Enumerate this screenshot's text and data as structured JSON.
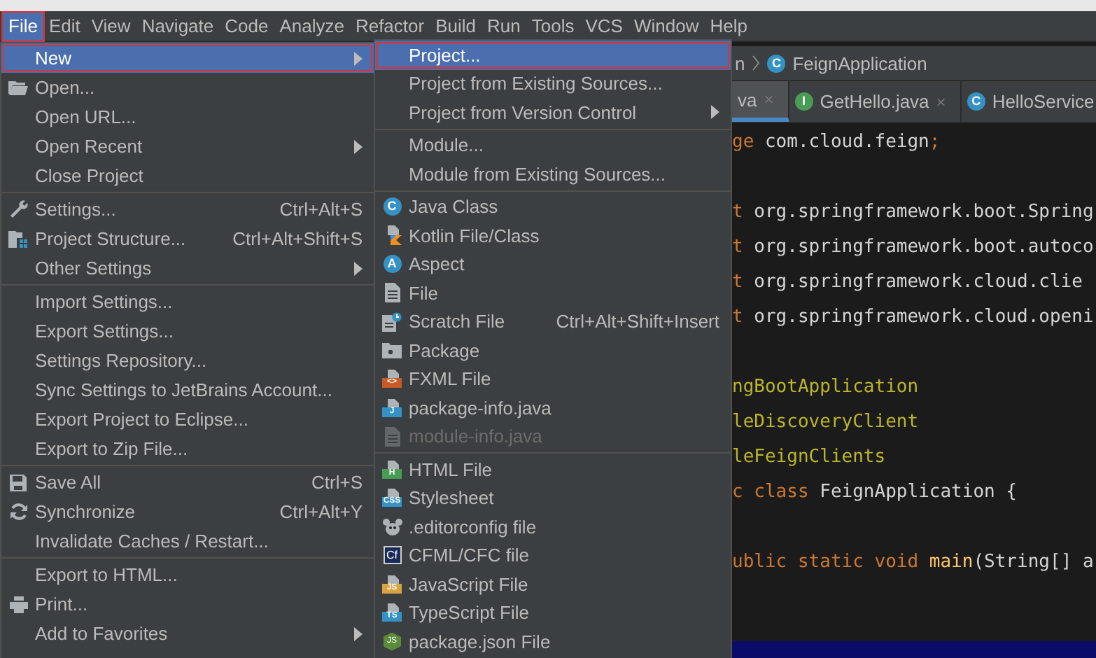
{
  "menubar": [
    {
      "label": "File",
      "selected": true,
      "outlined": true
    },
    {
      "label": "Edit",
      "selected": false,
      "outlined": false
    },
    {
      "label": "View",
      "selected": false,
      "outlined": false
    },
    {
      "label": "Navigate",
      "selected": false,
      "outlined": false
    },
    {
      "label": "Code",
      "selected": false,
      "outlined": false
    },
    {
      "label": "Analyze",
      "selected": false,
      "outlined": false
    },
    {
      "label": "Refactor",
      "selected": false,
      "outlined": false
    },
    {
      "label": "Build",
      "selected": false,
      "outlined": false
    },
    {
      "label": "Run",
      "selected": false,
      "outlined": false
    },
    {
      "label": "Tools",
      "selected": false,
      "outlined": false
    },
    {
      "label": "VCS",
      "selected": false,
      "outlined": false
    },
    {
      "label": "Window",
      "selected": false,
      "outlined": false
    },
    {
      "label": "Help",
      "selected": false,
      "outlined": false
    }
  ],
  "file_menu": [
    {
      "kind": "plain",
      "label": "New",
      "selected": true,
      "submenu": true,
      "outlined": true
    },
    {
      "kind": "folder",
      "label": "Open...",
      "selected": false,
      "submenu": false
    },
    {
      "kind": "plain",
      "label": "Open URL...",
      "selected": false,
      "submenu": false
    },
    {
      "kind": "plain",
      "label": "Open Recent",
      "selected": false,
      "submenu": true
    },
    {
      "kind": "plain",
      "label": "Close Project",
      "selected": false,
      "submenu": false
    },
    {
      "kind": "separator"
    },
    {
      "kind": "wrench",
      "label": "Settings...",
      "shortcut": "Ctrl+Alt+S",
      "selected": false,
      "submenu": false
    },
    {
      "kind": "structure",
      "label": "Project Structure...",
      "shortcut": "Ctrl+Alt+Shift+S",
      "selected": false,
      "submenu": false
    },
    {
      "kind": "plain",
      "label": "Other Settings",
      "selected": false,
      "submenu": true
    },
    {
      "kind": "separator"
    },
    {
      "kind": "plain",
      "label": "Import Settings...",
      "selected": false,
      "submenu": false
    },
    {
      "kind": "plain",
      "label": "Export Settings...",
      "selected": false,
      "submenu": false
    },
    {
      "kind": "plain",
      "label": "Settings Repository...",
      "selected": false,
      "submenu": false
    },
    {
      "kind": "plain",
      "label": "Sync Settings to JetBrains Account...",
      "selected": false,
      "submenu": false
    },
    {
      "kind": "plain",
      "label": "Export Project to Eclipse...",
      "selected": false,
      "submenu": false
    },
    {
      "kind": "plain",
      "label": "Export to Zip File...",
      "selected": false,
      "submenu": false
    },
    {
      "kind": "separator"
    },
    {
      "kind": "save",
      "label": "Save All",
      "shortcut": "Ctrl+S",
      "selected": false,
      "submenu": false
    },
    {
      "kind": "sync",
      "label": "Synchronize",
      "shortcut": "Ctrl+Alt+Y",
      "selected": false,
      "submenu": false
    },
    {
      "kind": "plain",
      "label": "Invalidate Caches / Restart...",
      "selected": false,
      "submenu": false
    },
    {
      "kind": "separator"
    },
    {
      "kind": "plain",
      "label": "Export to HTML...",
      "selected": false,
      "submenu": false
    },
    {
      "kind": "print",
      "label": "Print...",
      "selected": false,
      "submenu": false
    },
    {
      "kind": "plain",
      "label": "Add to Favorites",
      "selected": false,
      "submenu": true
    }
  ],
  "new_menu": [
    {
      "kind": "plain",
      "label": "Project...",
      "selected": true,
      "submenu": false,
      "disabled": false,
      "outlined": true
    },
    {
      "kind": "plain",
      "label": "Project from Existing Sources...",
      "selected": false,
      "submenu": false,
      "disabled": false
    },
    {
      "kind": "plain",
      "label": "Project from Version Control",
      "selected": false,
      "submenu": true,
      "disabled": false
    },
    {
      "kind": "separator"
    },
    {
      "kind": "plain",
      "label": "Module...",
      "selected": false,
      "submenu": false,
      "disabled": false
    },
    {
      "kind": "plain",
      "label": "Module from Existing Sources...",
      "selected": false,
      "submenu": false,
      "disabled": false
    },
    {
      "kind": "separator"
    },
    {
      "kind": "circle",
      "label": "Java Class",
      "icon_text": "C",
      "color": "#3592c4",
      "selected": false,
      "submenu": false,
      "disabled": false
    },
    {
      "kind": "kotlin",
      "label": "Kotlin File/Class",
      "selected": false,
      "submenu": false,
      "disabled": false
    },
    {
      "kind": "circle",
      "label": "Aspect",
      "icon_text": "A",
      "color": "#3592c4",
      "selected": false,
      "submenu": false,
      "disabled": false
    },
    {
      "kind": "file",
      "label": "File",
      "selected": false,
      "submenu": false,
      "disabled": false
    },
    {
      "kind": "scratch",
      "label": "Scratch File",
      "shortcut": "Ctrl+Alt+Shift+Insert",
      "selected": false,
      "submenu": false,
      "disabled": false
    },
    {
      "kind": "package",
      "label": "Package",
      "selected": false,
      "submenu": false,
      "disabled": false
    },
    {
      "kind": "tagged",
      "label": "FXML File",
      "icon_text": "<>",
      "color": "#c75b28",
      "selected": false,
      "submenu": false,
      "disabled": false
    },
    {
      "kind": "tagged",
      "label": "package-info.java",
      "icon_text": "J",
      "color": "#3592c4",
      "selected": false,
      "submenu": false,
      "disabled": false
    },
    {
      "kind": "file",
      "label": "module-info.java",
      "selected": false,
      "submenu": false,
      "disabled": true
    },
    {
      "kind": "separator"
    },
    {
      "kind": "tagged",
      "label": "HTML File",
      "icon_text": "H",
      "color": "#499c54",
      "selected": false,
      "submenu": false,
      "disabled": false
    },
    {
      "kind": "tagged",
      "label": "Stylesheet",
      "icon_text": "CSS",
      "color": "#3592c4",
      "selected": false,
      "submenu": false,
      "disabled": false
    },
    {
      "kind": "mouse",
      "label": ".editorconfig file",
      "selected": false,
      "submenu": false,
      "disabled": false
    },
    {
      "kind": "square",
      "label": "CFML/CFC file",
      "icon_text": "Cf",
      "color": "#1a2a5a",
      "selected": false,
      "submenu": false,
      "disabled": false
    },
    {
      "kind": "tagged",
      "label": "JavaScript File",
      "icon_text": "JS",
      "color": "#d9a343",
      "selected": false,
      "submenu": false,
      "disabled": false
    },
    {
      "kind": "tagged",
      "label": "TypeScript File",
      "icon_text": "TS",
      "color": "#3592c4",
      "selected": false,
      "submenu": false,
      "disabled": false
    },
    {
      "kind": "hexagon",
      "label": "package.json File",
      "icon_text": "JS",
      "color": "#5a8a3a",
      "selected": false,
      "submenu": false,
      "disabled": false
    }
  ],
  "breadcrumb": {
    "before": "n",
    "icon_text": "C",
    "label": "FeignApplication"
  },
  "tabs": [
    {
      "label": "va",
      "close": "×",
      "selected": true
    },
    {
      "label": "GetHello.java",
      "icon_text": "I",
      "color": "#499c54",
      "close": "×",
      "selected": false
    },
    {
      "label": "HelloService",
      "icon_text": "C",
      "color": "#3592c4",
      "selected": false
    }
  ],
  "code_blocks": [
    [
      [
        {
          "kind": "keyword",
          "text": "ge"
        },
        {
          "kind": "plain",
          "text": " com.cloud.feign"
        },
        {
          "kind": "keyword",
          "text": ";"
        }
      ]
    ],
    [
      [
        {
          "kind": "keyword",
          "text": "t"
        },
        {
          "kind": "plain",
          "text": " org.springframework.boot.Spring"
        }
      ],
      [
        {
          "kind": "keyword",
          "text": "t"
        },
        {
          "kind": "plain",
          "text": " org.springframework.boot.autoco"
        }
      ],
      [
        {
          "kind": "keyword",
          "text": "t"
        },
        {
          "kind": "plain",
          "text": " org.springframework.cloud.clie"
        }
      ],
      [
        {
          "kind": "keyword",
          "text": "t"
        },
        {
          "kind": "plain",
          "text": " org.springframework.cloud.openi"
        }
      ]
    ],
    [
      [
        {
          "kind": "annotation",
          "text": "ngBootApplication"
        }
      ],
      [
        {
          "kind": "annotation",
          "text": "leDiscoveryClient"
        }
      ],
      [
        {
          "kind": "annotation",
          "text": "leFeignClients"
        }
      ],
      [
        {
          "kind": "keyword",
          "text": "c class"
        },
        {
          "kind": "plain",
          "text": " FeignApplication {"
        }
      ]
    ],
    [
      [
        {
          "kind": "keyword",
          "text": "ublic static void"
        },
        {
          "kind": "function",
          "text": " main"
        },
        {
          "kind": "plain",
          "text": "(String[] a"
        }
      ]
    ]
  ]
}
